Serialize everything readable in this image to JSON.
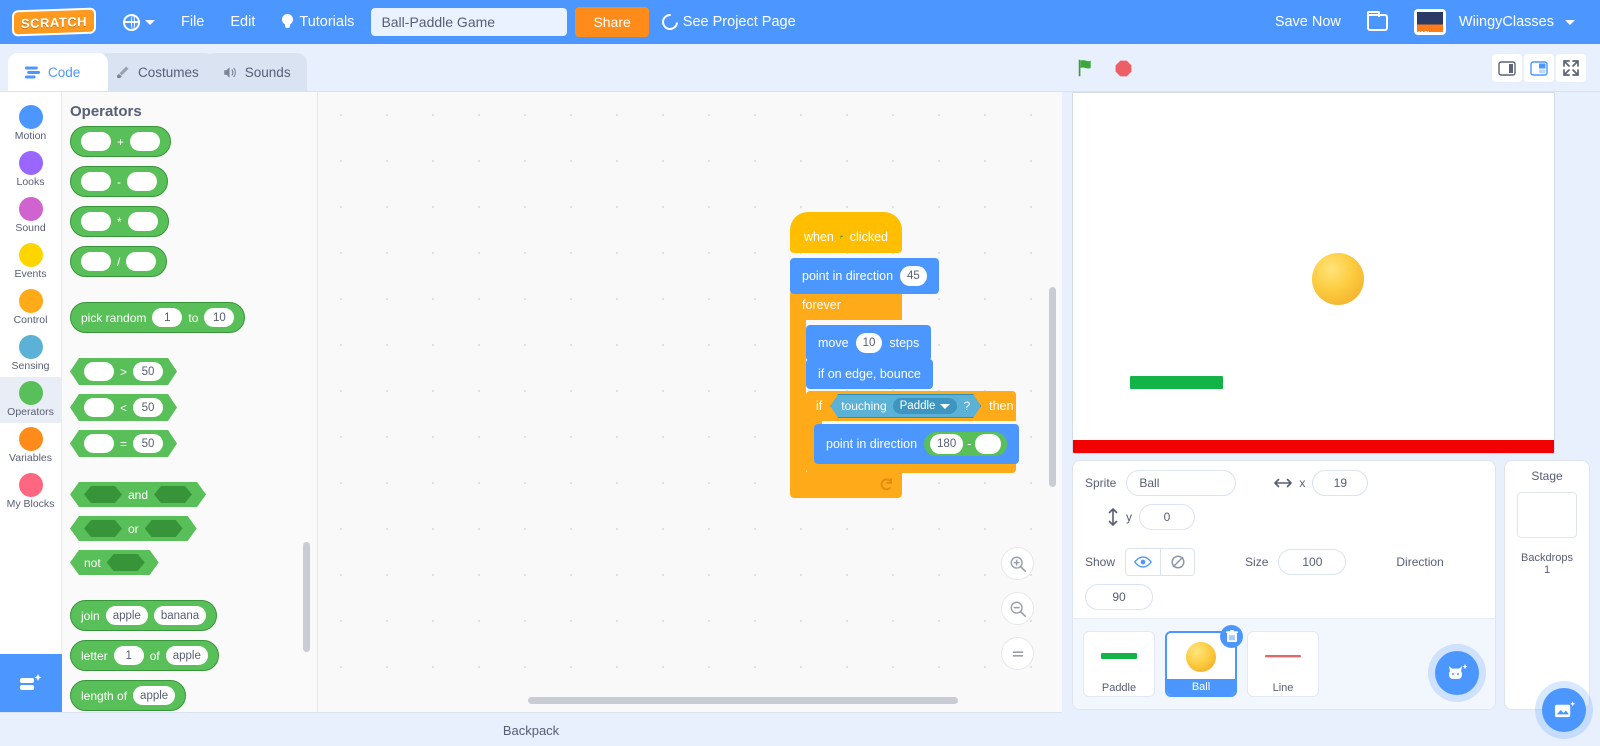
{
  "menubar": {
    "logo_text": "SCRATCH",
    "logo_icon": "scratch-logo",
    "language_icon": "globe-icon",
    "file_label": "File",
    "edit_label": "Edit",
    "tutorials_label": "Tutorials",
    "tutorials_icon": "lightbulb-icon",
    "project_title": "Ball-Paddle Game",
    "project_title_placeholder": "Project title",
    "share_label": "Share",
    "see_project_page_label": "See Project Page",
    "see_project_page_icon": "revert-arrow-icon",
    "save_now_label": "Save Now",
    "folder_icon": "folder-icon",
    "account_name": "WiingyClasses",
    "account_avatar": "wiingy-avatar",
    "account_caret_icon": "chevron-down-icon",
    "accent_blue": "#4c97ff",
    "share_orange": "#ff8c1a"
  },
  "tabs": [
    {
      "label": "Code",
      "icon": "code-icon",
      "active": true
    },
    {
      "label": "Costumes",
      "icon": "brush-icon",
      "active": false
    },
    {
      "label": "Sounds",
      "icon": "speaker-icon",
      "active": false
    }
  ],
  "stage_controls": {
    "green_flag_icon": "green-flag-icon",
    "stop_icon": "stop-sign-icon",
    "small_stage_icon": "small-stage-layout-icon",
    "large_stage_icon": "large-stage-layout-icon",
    "fullscreen_icon": "fullscreen-icon"
  },
  "categories": [
    {
      "label": "Motion",
      "color": "#4c97ff",
      "selected": false
    },
    {
      "label": "Looks",
      "color": "#9966ff",
      "selected": false
    },
    {
      "label": "Sound",
      "color": "#cf63cf",
      "selected": false
    },
    {
      "label": "Events",
      "color": "#ffd500",
      "selected": false
    },
    {
      "label": "Control",
      "color": "#ffab19",
      "selected": false
    },
    {
      "label": "Sensing",
      "color": "#5cb1d6",
      "selected": false
    },
    {
      "label": "Operators",
      "color": "#59c059",
      "selected": true
    },
    {
      "label": "Variables",
      "color": "#ff8c1a",
      "selected": false
    },
    {
      "label": "My Blocks",
      "color": "#ff6680",
      "selected": false
    }
  ],
  "extension_button": {
    "icon": "add-extension-icon"
  },
  "palette": {
    "title": "Operators",
    "blocks": [
      {
        "id": "add",
        "kind": "reporter",
        "parts": [
          {
            "t": "slot",
            "v": ""
          },
          {
            "t": "label",
            "v": "+"
          },
          {
            "t": "slot",
            "v": ""
          }
        ]
      },
      {
        "id": "subtract",
        "kind": "reporter",
        "parts": [
          {
            "t": "slot",
            "v": ""
          },
          {
            "t": "label",
            "v": "-"
          },
          {
            "t": "slot",
            "v": ""
          }
        ]
      },
      {
        "id": "multiply",
        "kind": "reporter",
        "parts": [
          {
            "t": "slot",
            "v": ""
          },
          {
            "t": "label",
            "v": "*"
          },
          {
            "t": "slot",
            "v": ""
          }
        ]
      },
      {
        "id": "divide",
        "kind": "reporter",
        "parts": [
          {
            "t": "slot",
            "v": ""
          },
          {
            "t": "label",
            "v": "/"
          },
          {
            "t": "slot",
            "v": ""
          }
        ]
      },
      {
        "id": "gap1",
        "kind": "gap"
      },
      {
        "id": "pick-random",
        "kind": "reporter",
        "parts": [
          {
            "t": "label",
            "v": "pick random"
          },
          {
            "t": "slot",
            "v": "1"
          },
          {
            "t": "label",
            "v": "to"
          },
          {
            "t": "slot",
            "v": "10"
          }
        ]
      },
      {
        "id": "gap2",
        "kind": "gap"
      },
      {
        "id": "greater",
        "kind": "boolean",
        "parts": [
          {
            "t": "slot",
            "v": ""
          },
          {
            "t": "label",
            "v": ">"
          },
          {
            "t": "slot",
            "v": "50"
          }
        ]
      },
      {
        "id": "less",
        "kind": "boolean",
        "parts": [
          {
            "t": "slot",
            "v": ""
          },
          {
            "t": "label",
            "v": "<"
          },
          {
            "t": "slot",
            "v": "50"
          }
        ]
      },
      {
        "id": "equals",
        "kind": "boolean",
        "parts": [
          {
            "t": "slot",
            "v": ""
          },
          {
            "t": "label",
            "v": "="
          },
          {
            "t": "slot",
            "v": "50"
          }
        ]
      },
      {
        "id": "gap3",
        "kind": "gap"
      },
      {
        "id": "and",
        "kind": "boolean",
        "parts": [
          {
            "t": "hex",
            "v": ""
          },
          {
            "t": "label",
            "v": "and"
          },
          {
            "t": "hex",
            "v": ""
          }
        ]
      },
      {
        "id": "or",
        "kind": "boolean",
        "parts": [
          {
            "t": "hex",
            "v": ""
          },
          {
            "t": "label",
            "v": "or"
          },
          {
            "t": "hex",
            "v": ""
          }
        ]
      },
      {
        "id": "not",
        "kind": "boolean",
        "parts": [
          {
            "t": "label",
            "v": "not"
          },
          {
            "t": "hex",
            "v": ""
          }
        ]
      },
      {
        "id": "gap4",
        "kind": "gap"
      },
      {
        "id": "join",
        "kind": "reporter",
        "parts": [
          {
            "t": "label",
            "v": "join"
          },
          {
            "t": "slot",
            "v": "apple"
          },
          {
            "t": "slot",
            "v": "banana"
          }
        ]
      },
      {
        "id": "letter-of",
        "kind": "reporter",
        "parts": [
          {
            "t": "label",
            "v": "letter"
          },
          {
            "t": "slot",
            "v": "1"
          },
          {
            "t": "label",
            "v": "of"
          },
          {
            "t": "slot",
            "v": "apple"
          }
        ]
      },
      {
        "id": "length-of",
        "kind": "reporter",
        "parts": [
          {
            "t": "label",
            "v": "length of"
          },
          {
            "t": "slot",
            "v": "apple"
          }
        ]
      }
    ]
  },
  "script": {
    "when_flag_clicked": {
      "pre": "when",
      "flag_icon": "green-flag-icon",
      "post": "clicked"
    },
    "point_in_direction_1": {
      "label": "point in direction",
      "value": "45"
    },
    "forever": {
      "label": "forever",
      "loop_icon": "loop-arrow-icon"
    },
    "move_steps": {
      "pre": "move",
      "value": "10",
      "post": "steps"
    },
    "if_on_edge_bounce": {
      "label": "if on edge, bounce"
    },
    "if_then": {
      "pre": "if",
      "post": "then"
    },
    "touching": {
      "pre": "touching",
      "target": "Paddle",
      "question": "?",
      "dropdown_icon": "chevron-down-icon"
    },
    "point_in_direction_2": {
      "label": "point in direction",
      "value": "180",
      "operator": "-",
      "operand": ""
    }
  },
  "workspace_controls": {
    "zoom_in_icon": "zoom-in-icon",
    "zoom_out_icon": "zoom-out-icon",
    "zoom_reset_icon": "zoom-reset-icon"
  },
  "stage": {
    "ball_sprite": "ball-sprite",
    "paddle_sprite": "paddle-sprite",
    "line_sprite": "line-sprite",
    "paddle_color": "#12b347",
    "line_color": "#f20000"
  },
  "sprite_info": {
    "sprite_label": "Sprite",
    "sprite_name": "Ball",
    "x_label": "x",
    "x_value": "19",
    "y_label": "y",
    "y_value": "0",
    "x_icon": "arrows-horizontal-icon",
    "y_icon": "arrows-vertical-icon",
    "show_label": "Show",
    "show_on_icon": "eye-icon",
    "show_off_icon": "eye-slash-icon",
    "size_label": "Size",
    "size_value": "100",
    "direction_label": "Direction",
    "direction_value": "90"
  },
  "sprites": [
    {
      "name": "Paddle",
      "selected": false,
      "thumb": "paddle-thumb"
    },
    {
      "name": "Ball",
      "selected": true,
      "thumb": "ball-thumb",
      "delete_icon": "trash-icon"
    },
    {
      "name": "Line",
      "selected": false,
      "thumb": "line-thumb"
    }
  ],
  "add_sprite_button": {
    "icon": "choose-sprite-cat-icon"
  },
  "stage_panel": {
    "header": "Stage",
    "backdrops_label": "Backdrops",
    "backdrops_count": "1",
    "add_backdrop_icon": "choose-backdrop-image-icon"
  },
  "backpack": {
    "label": "Backpack"
  }
}
